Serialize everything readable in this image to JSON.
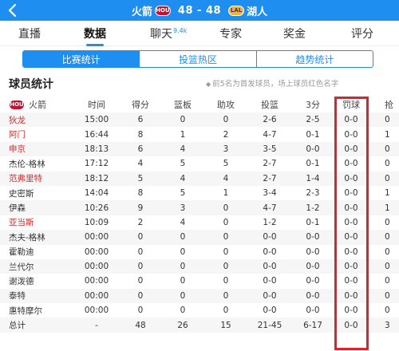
{
  "header": {
    "home_team": "火箭",
    "home_logo": "HOU",
    "score": "48 - 48",
    "away_logo": "LAL",
    "away_team": "湖人"
  },
  "nav": {
    "tabs": [
      "直播",
      "数据",
      "聊天",
      "专家",
      "奖金",
      "评分"
    ],
    "chat_badge": "9.4k",
    "active": "数据"
  },
  "segments": {
    "items": [
      "比赛统计",
      "投篮热区",
      "趋势统计"
    ],
    "active": "比赛统计"
  },
  "section": {
    "title": "球员统计",
    "note": "前5名为首发球员，场上球员红色名字"
  },
  "table": {
    "team_label": "火箭",
    "columns": [
      "时间",
      "得分",
      "篮板",
      "助攻",
      "投篮",
      "3分",
      "罚球",
      "抢"
    ],
    "rows": [
      {
        "name": "狄龙",
        "starter": true,
        "cells": [
          "15:00",
          "6",
          "0",
          "0",
          "2-6",
          "2-5",
          "0-0",
          "0"
        ]
      },
      {
        "name": "阿门",
        "starter": true,
        "cells": [
          "16:44",
          "8",
          "1",
          "2",
          "4-7",
          "0-1",
          "0-0",
          "1"
        ]
      },
      {
        "name": "申京",
        "starter": true,
        "cells": [
          "18:13",
          "6",
          "4",
          "3",
          "3-5",
          "0-0",
          "0-0",
          "0"
        ]
      },
      {
        "name": "杰伦-格林",
        "starter": false,
        "cells": [
          "17:12",
          "4",
          "5",
          "5",
          "2-7",
          "0-1",
          "0-0",
          "0"
        ]
      },
      {
        "name": "范弗里特",
        "starter": true,
        "cells": [
          "18:12",
          "5",
          "4",
          "4",
          "2-7",
          "1-4",
          "0-0",
          "0"
        ]
      },
      {
        "name": "史密斯",
        "starter": false,
        "cells": [
          "14:04",
          "8",
          "5",
          "1",
          "3-4",
          "2-3",
          "0-0",
          "1"
        ]
      },
      {
        "name": "伊森",
        "starter": false,
        "cells": [
          "10:26",
          "9",
          "3",
          "0",
          "4-7",
          "1-2",
          "0-0",
          "1"
        ]
      },
      {
        "name": "亚当斯",
        "starter": true,
        "cells": [
          "10:09",
          "2",
          "4",
          "0",
          "1-2",
          "0-1",
          "0-0",
          "0"
        ]
      },
      {
        "name": "杰夫-格林",
        "starter": false,
        "cells": [
          "00:00",
          "0",
          "0",
          "0",
          "0-0",
          "0-0",
          "0-0",
          "0"
        ]
      },
      {
        "name": "霍勒迪",
        "starter": false,
        "cells": [
          "00:00",
          "0",
          "0",
          "0",
          "0-0",
          "0-0",
          "0-0",
          "0"
        ]
      },
      {
        "name": "兰代尔",
        "starter": false,
        "cells": [
          "00:00",
          "0",
          "0",
          "0",
          "0-0",
          "0-0",
          "0-0",
          "0"
        ]
      },
      {
        "name": "谢泼德",
        "starter": false,
        "cells": [
          "00:00",
          "0",
          "0",
          "0",
          "0-0",
          "0-0",
          "0-0",
          "0"
        ]
      },
      {
        "name": "泰特",
        "starter": false,
        "cells": [
          "00:00",
          "0",
          "0",
          "0",
          "0-0",
          "0-0",
          "0-0",
          "0"
        ]
      },
      {
        "name": "惠特摩尔",
        "starter": false,
        "cells": [
          "00:00",
          "0",
          "0",
          "0",
          "0-0",
          "0-0",
          "0-0",
          "0"
        ]
      },
      {
        "name": "总计",
        "starter": false,
        "cells": [
          "-",
          "48",
          "26",
          "15",
          "21-45",
          "6-17",
          "0-0",
          "3"
        ]
      }
    ]
  },
  "colors": {
    "accent": "#1f8ef1",
    "starter_name": "#d6292b",
    "highlight": "#e2202c"
  }
}
